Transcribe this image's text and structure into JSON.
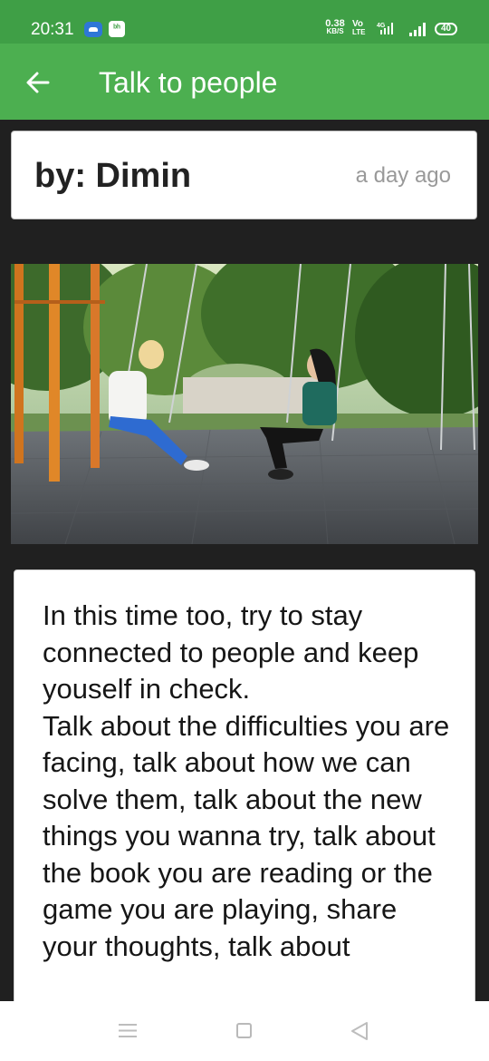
{
  "status_bar": {
    "time": "20:31",
    "net_speed_value": "0.38",
    "net_speed_unit": "KB/S",
    "volte_top": "Vo",
    "volte_bottom": "LTE",
    "network_type": "4G",
    "battery": "40"
  },
  "app_bar": {
    "title": "Talk to people",
    "back_icon": "back-arrow-icon",
    "color": "#4caf50"
  },
  "post": {
    "author": "by: Dimin",
    "date": "a day ago",
    "body": "In this time too, try to stay connected to people and keep youself in check.\nTalk about the difficulties you are facing, talk about how we can solve them, talk about the new things you wanna try, talk about the book you are reading or the game you are playing, share your thoughts, talk about"
  },
  "nav_bar": {
    "menu_icon": "menu-icon",
    "home_icon": "home-icon",
    "back_icon": "back-triangle-icon"
  }
}
